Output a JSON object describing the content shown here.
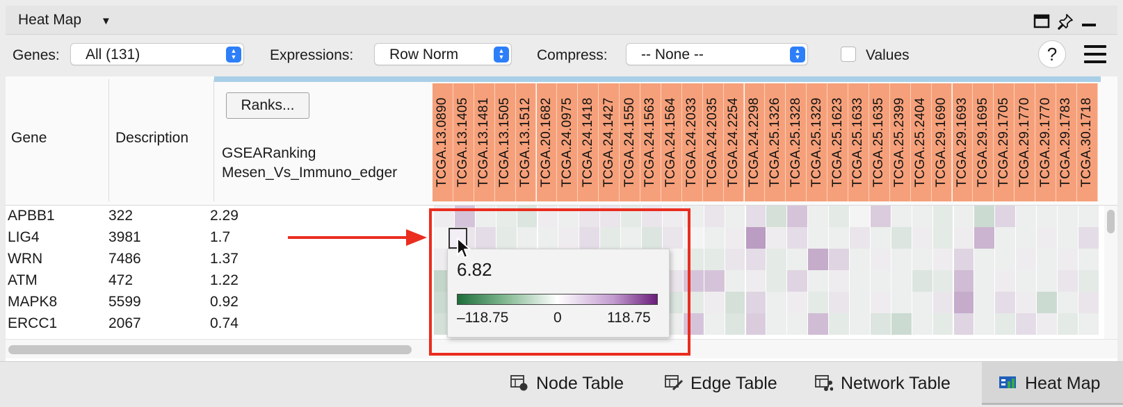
{
  "panel": {
    "title": "Heat Map",
    "caret": "▼"
  },
  "toolbar": {
    "genes_label": "Genes:",
    "genes_value": "All (131)",
    "expressions_label": "Expressions:",
    "expressions_value": "Row Norm",
    "compress_label": "Compress:",
    "compress_value": "-- None --",
    "values_label": "Values",
    "values_checked": false,
    "help_label": "?"
  },
  "table": {
    "columns": {
      "gene": "Gene",
      "description": "Description",
      "ranks_button": "Ranks...",
      "rank_line1": "GSEARanking",
      "rank_line2": "Mesen_Vs_Immuno_edger"
    },
    "samples": [
      "TCGA.13.0890",
      "TCGA.13.1405",
      "TCGA.13.1481",
      "TCGA.13.1505",
      "TCGA.13.1512",
      "TCGA.20.1682",
      "TCGA.24.0975",
      "TCGA.24.1418",
      "TCGA.24.1427",
      "TCGA.24.1550",
      "TCGA.24.1563",
      "TCGA.24.1564",
      "TCGA.24.2033",
      "TCGA.24.2035",
      "TCGA.24.2254",
      "TCGA.24.2298",
      "TCGA.25.1326",
      "TCGA.25.1328",
      "TCGA.25.1329",
      "TCGA.25.1623",
      "TCGA.25.1633",
      "TCGA.25.1635",
      "TCGA.25.2399",
      "TCGA.25.2404",
      "TCGA.29.1690",
      "TCGA.29.1693",
      "TCGA.29.1695",
      "TCGA.29.1705",
      "TCGA.29.1770",
      "TCGA.29.1770",
      "TCGA.29.1783",
      "TCGA.30.1718"
    ],
    "rows": [
      {
        "gene": "APBB1",
        "description": "322",
        "rank": "2.29"
      },
      {
        "gene": "LIG4",
        "description": "3981",
        "rank": "1.7"
      },
      {
        "gene": "WRN",
        "description": "7486",
        "rank": "1.37"
      },
      {
        "gene": "ATM",
        "description": "472",
        "rank": "1.22"
      },
      {
        "gene": "MAPK8",
        "description": "5599",
        "rank": "0.92"
      },
      {
        "gene": "ERCC1",
        "description": "2067",
        "rank": "0.74"
      }
    ],
    "heat_values": [
      [
        0.05,
        0.3,
        -0.05,
        -0.08,
        -0.15,
        0.05,
        -0.05,
        0.1,
        0.1,
        -0.1,
        0.1,
        0.05,
        -0.05,
        0.1,
        -0.05,
        0.15,
        -0.2,
        0.3,
        -0.05,
        -0.1,
        0.0,
        0.25,
        -0.05,
        -0.05,
        -0.1,
        -0.05,
        -0.25,
        0.2,
        -0.05,
        -0.05,
        -0.05,
        -0.05
      ],
      [
        0.0,
        0.1,
        0.15,
        -0.1,
        -0.05,
        -0.05,
        0.05,
        0.15,
        -0.1,
        -0.05,
        -0.15,
        0.1,
        0.0,
        -0.05,
        0.05,
        0.55,
        0.05,
        0.15,
        -0.05,
        -0.05,
        0.1,
        -0.05,
        -0.15,
        0.05,
        -0.1,
        0.05,
        0.4,
        -0.05,
        -0.05,
        0.05,
        -0.05,
        0.15
      ],
      [
        0.05,
        0.0,
        0.0,
        0.0,
        0.0,
        0.0,
        0.0,
        0.0,
        0.0,
        0.0,
        0.0,
        0.0,
        -0.1,
        -0.1,
        0.1,
        0.15,
        -0.1,
        -0.05,
        0.45,
        0.2,
        -0.05,
        0.05,
        -0.05,
        -0.05,
        0.05,
        0.2,
        -0.05,
        -0.05,
        0.05,
        -0.05,
        0.05,
        -0.05
      ],
      [
        -0.3,
        0.0,
        0.0,
        0.0,
        0.0,
        0.0,
        0.0,
        0.0,
        0.0,
        0.0,
        0.0,
        0.1,
        0.3,
        0.3,
        -0.05,
        0.05,
        -0.1,
        0.2,
        -0.05,
        0.05,
        -0.05,
        -0.05,
        -0.05,
        -0.15,
        -0.1,
        0.35,
        -0.05,
        0.05,
        -0.05,
        -0.05,
        0.1,
        -0.1
      ],
      [
        -0.25,
        0.0,
        0.0,
        0.0,
        0.0,
        0.0,
        0.0,
        0.0,
        0.0,
        0.0,
        0.0,
        -0.15,
        -0.1,
        0.05,
        -0.2,
        0.2,
        -0.05,
        0.05,
        -0.1,
        0.1,
        -0.05,
        0.05,
        -0.05,
        -0.05,
        0.1,
        0.45,
        -0.05,
        0.15,
        0.05,
        -0.25,
        -0.05,
        0.1
      ],
      [
        -0.2,
        0.0,
        0.0,
        0.0,
        0.0,
        0.0,
        0.0,
        0.0,
        0.0,
        0.0,
        0.0,
        -0.05,
        0.3,
        -0.05,
        -0.15,
        0.25,
        -0.05,
        -0.05,
        0.35,
        -0.1,
        -0.05,
        -0.15,
        -0.25,
        -0.05,
        -0.1,
        0.2,
        -0.05,
        -0.1,
        0.15,
        0.05,
        -0.1,
        -0.05
      ]
    ],
    "highlight_row": 1,
    "highlight_col": 1
  },
  "tooltip": {
    "value": "6.82",
    "legend_min": "–118.75",
    "legend_mid": "0",
    "legend_max": "118.75"
  },
  "colors": {
    "sample_header": "#f5a07a",
    "negative": "#1e6e3a",
    "positive": "#6a1e7a",
    "annotation": "#ea2d1f"
  },
  "tabs": [
    {
      "label": "Node Table",
      "icon": "node-table-icon",
      "active": false
    },
    {
      "label": "Edge Table",
      "icon": "edge-table-icon",
      "active": false
    },
    {
      "label": "Network Table",
      "icon": "network-table-icon",
      "active": false
    },
    {
      "label": "Heat Map",
      "icon": "heat-map-icon",
      "active": true
    }
  ]
}
